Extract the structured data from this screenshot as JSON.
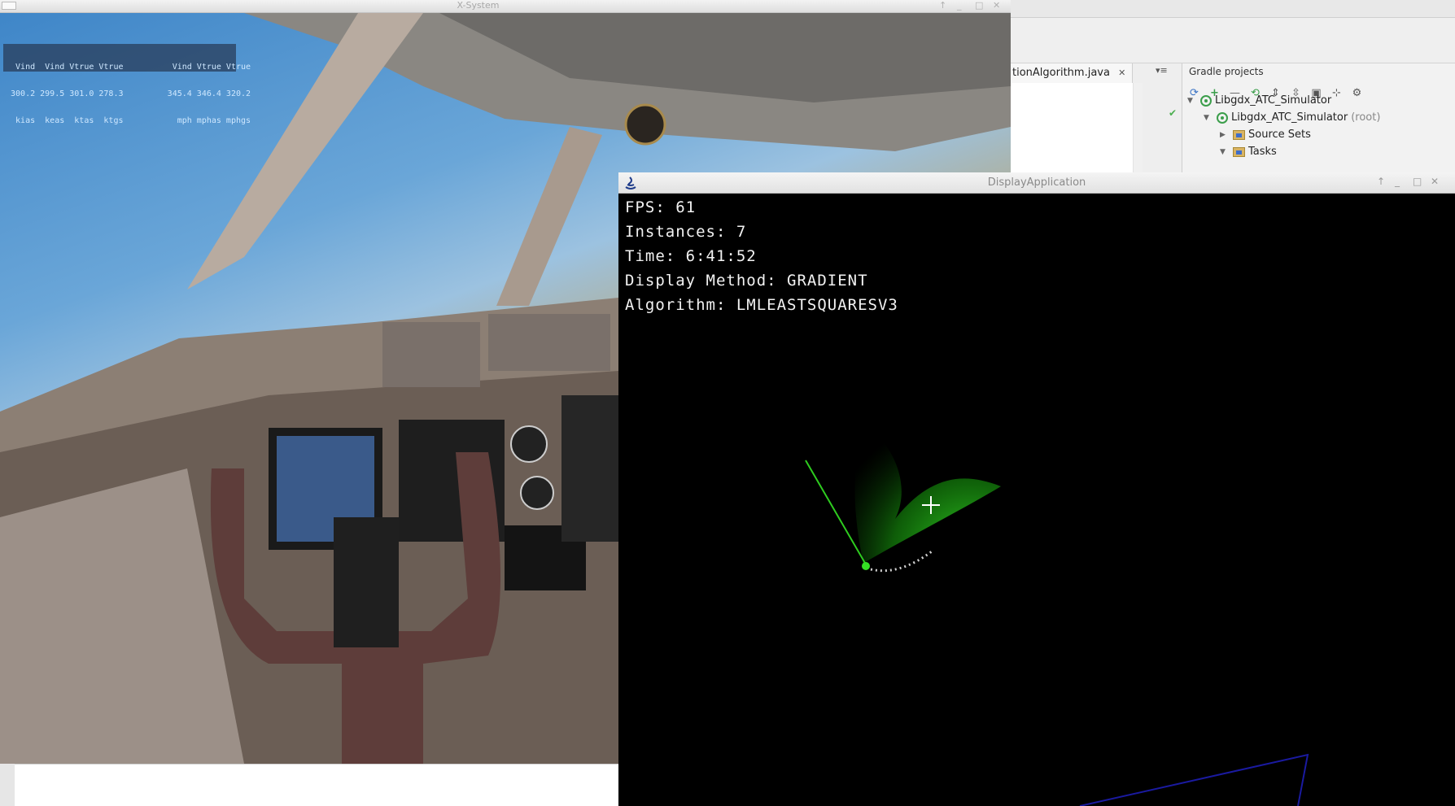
{
  "xsystem": {
    "title": "X-System",
    "hud": {
      "row1": "  Vind  Vind Vtrue Vtrue          Vind Vtrue Vtrue",
      "row2": " 300.2 299.5 301.0 278.3         345.4 346.4 320.2",
      "row3": "  kias  keas  ktas  ktgs           mph mphas mphgs"
    },
    "window_buttons": [
      "↑",
      "_",
      "□",
      "✕"
    ]
  },
  "ide": {
    "editor_tab": "tionAlgorithm.java",
    "tab_close": "✕",
    "gradle": {
      "panel_title": "Gradle projects",
      "toolbar_icons": [
        "refresh-icon",
        "add-icon",
        "remove-icon",
        "sync-icon",
        "expand-all-icon",
        "collapse-all-icon",
        "link-icon",
        "toggle-offline-icon",
        "settings-icon"
      ],
      "tree": [
        {
          "label": "Libgdx_ATC_Simulator",
          "suffix": "",
          "level": 0,
          "icon": "gradle-icon"
        },
        {
          "label": "Libgdx_ATC_Simulator",
          "suffix": "(root)",
          "level": 1,
          "icon": "gradle-icon"
        },
        {
          "label": "Source Sets",
          "suffix": "",
          "level": 2,
          "icon": "folder-icon"
        },
        {
          "label": "Tasks",
          "suffix": "",
          "level": 2,
          "icon": "folder-icon"
        }
      ]
    }
  },
  "display": {
    "title": "DisplayApplication",
    "window_buttons": [
      "↑",
      "_",
      "□",
      "✕"
    ],
    "overlay": {
      "fps": "FPS: 61",
      "instances": "Instances: 7",
      "time": "Time: 6:41:52",
      "display_method": "Display Method: GRADIENT",
      "algorithm": "Algorithm: LMLEASTSQUARESV3"
    },
    "colors": {
      "track_line": "#2ecc1f",
      "gradient": "#1fbf10",
      "history_dots": "#cfcfcf",
      "cursor": "#ffffff",
      "boundary": "#1a1aa0"
    }
  }
}
